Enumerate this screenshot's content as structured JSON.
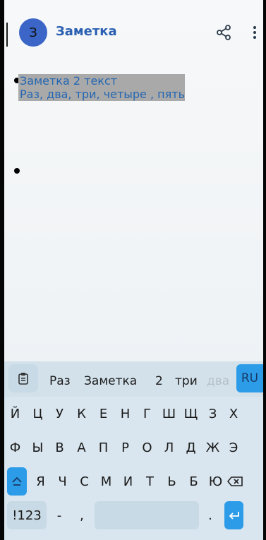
{
  "appbar": {
    "avatar_letter": "З",
    "title": "Заметка"
  },
  "note": {
    "lines": [
      "Заметка 2 текст",
      "Раз, два, три, четыре , пять"
    ]
  },
  "keyboard": {
    "suggestions": [
      "Раз",
      "Заметка",
      "2",
      "три",
      "два"
    ],
    "lang": "RU",
    "row1": [
      "Й",
      "Ц",
      "У",
      "К",
      "Е",
      "Н",
      "Г",
      "Ш",
      "Щ",
      "З",
      "Х"
    ],
    "row2": [
      "Ф",
      "Ы",
      "В",
      "А",
      "П",
      "Р",
      "О",
      "Л",
      "Д",
      "Ж",
      "Э"
    ],
    "row3": [
      "Я",
      "Ч",
      "С",
      "М",
      "И",
      "Т",
      "Ь",
      "Б",
      "Ю"
    ],
    "numeric_label": "!123",
    "dash": "-",
    "comma": ",",
    "period": "."
  }
}
